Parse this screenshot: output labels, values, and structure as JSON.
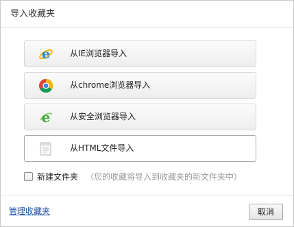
{
  "dialog": {
    "title": "导入收藏夹"
  },
  "options": [
    {
      "label": "从IE浏览器导入",
      "icon": "ie-icon"
    },
    {
      "label": "从chrome浏览器导入",
      "icon": "chrome-icon"
    },
    {
      "label": "从安全浏览器导入",
      "icon": "safe-browser-icon"
    },
    {
      "label": "从HTML文件导入",
      "icon": "html-file-icon"
    }
  ],
  "new_folder": {
    "label": "新建文件夹",
    "note": "（您的收藏将导入到收藏夹的新文件夹中）",
    "checked": false
  },
  "footer": {
    "manage_link": "管理收藏夹",
    "cancel_label": "取消"
  },
  "colors": {
    "ie_blue": "#1e88d9",
    "safe_green": "#3daa35",
    "link_blue": "#1f4fa6",
    "note_gray": "#9a9a9a"
  }
}
